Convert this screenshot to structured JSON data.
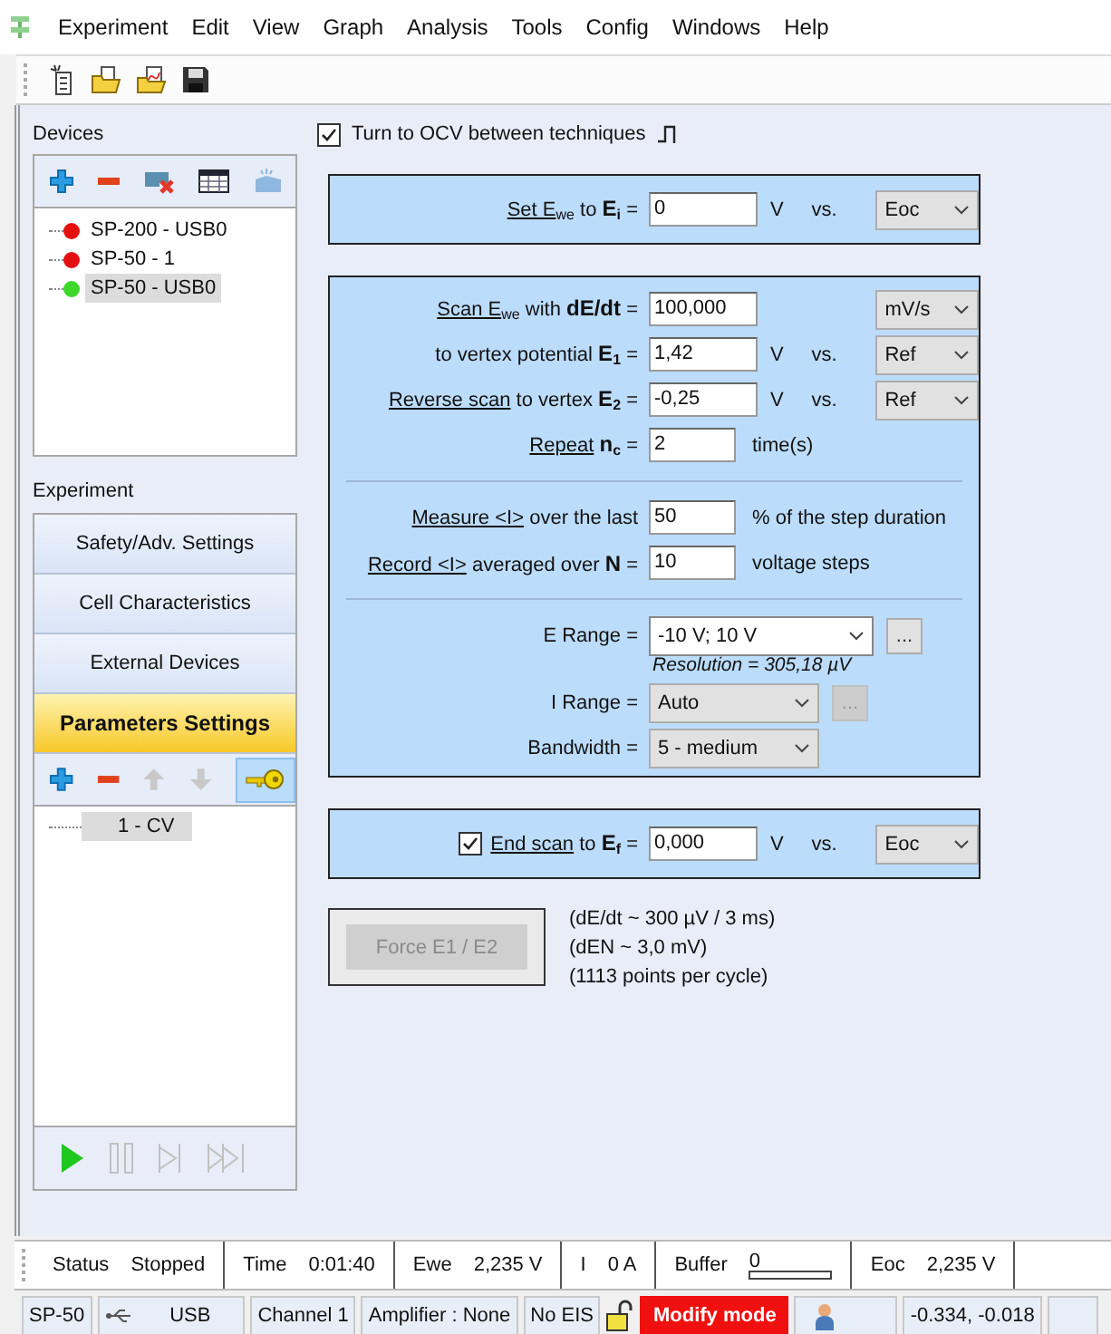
{
  "menu": [
    "Experiment",
    "Edit",
    "View",
    "Graph",
    "Analysis",
    "Tools",
    "Config",
    "Windows",
    "Help"
  ],
  "devices": {
    "label": "Devices",
    "items": [
      {
        "name": "SP-200 - USB0",
        "color": "#e41010",
        "selected": false
      },
      {
        "name": "SP-50 - 1",
        "color": "#e41010",
        "selected": false
      },
      {
        "name": "SP-50 - USB0",
        "color": "#3ed82a",
        "selected": true
      }
    ]
  },
  "experiment": {
    "label": "Experiment",
    "buttons": [
      {
        "label": "Safety/Adv. Settings",
        "selected": false
      },
      {
        "label": "Cell Characteristics",
        "selected": false
      },
      {
        "label": "External Devices",
        "selected": false
      },
      {
        "label": "Parameters Settings",
        "selected": true
      }
    ],
    "key_active": true,
    "techniques": [
      {
        "label": "1 - CV",
        "selected": true
      }
    ]
  },
  "ocv": {
    "label": "Turn to OCV between techniques",
    "checked": true
  },
  "set_ewe": {
    "link": "Set E$_{we}$",
    "label": "to **E**$_{i}$ =",
    "value": "0",
    "unit": "V",
    "vs": "vs.",
    "reference": "Eoc"
  },
  "scan": {
    "rows": [
      {
        "kind": "input",
        "link": "Scan E$_{we}$",
        "label": "with **dE/dt** =",
        "value": "100,000",
        "unit_select": "mV/s"
      },
      {
        "kind": "input",
        "label": "to vertex potential  **E**$_{1}$ =",
        "value": "1,42",
        "unit": "V",
        "vs": "vs.",
        "reference": "Ref"
      },
      {
        "kind": "input",
        "link": "Reverse scan",
        "label": "to vertex  **E**$_{2}$ =",
        "value": "-0,25",
        "unit": "V",
        "vs": "vs.",
        "reference": "Ref"
      },
      {
        "kind": "input",
        "link": "Repeat",
        "label": "**n**$_{c}$ =",
        "value": "2",
        "after": "time(s)"
      },
      {
        "kind": "divider"
      },
      {
        "kind": "input",
        "link": "Measure <I>",
        "label": "over the last",
        "value": "50",
        "after": "% of the step duration"
      },
      {
        "kind": "input",
        "link": "Record <I>",
        "label": "averaged over  **N** =",
        "value": "10",
        "after": "voltage steps"
      },
      {
        "kind": "divider"
      },
      {
        "kind": "range",
        "label": "E Range =",
        "value": "-10 V; 10 V",
        "editable": true,
        "more": "...",
        "more_disabled": false,
        "note": "Resolution = 305,18 µV"
      },
      {
        "kind": "range",
        "label": "I Range =",
        "value": "Auto",
        "editable": false,
        "more": "...",
        "more_disabled": true
      },
      {
        "kind": "range",
        "label": "Bandwidth =",
        "value": "5 - medium",
        "editable": false
      }
    ]
  },
  "end_scan": {
    "checked": true,
    "link": "End scan",
    "label": "to **E**$_{f}$ =",
    "value": "0,000",
    "unit": "V",
    "vs": "vs.",
    "reference": "Eoc"
  },
  "force_button": {
    "label": "Force E1 / E2",
    "disabled": true
  },
  "notes": [
    "(dE/dt ~ 300 µV / 3 ms)",
    "(dEN ~ 3,0 mV)",
    "(1113 points per cycle)"
  ],
  "status": [
    {
      "label": "Status",
      "value": "Stopped"
    },
    {
      "label": "Time",
      "value": "0:01:40"
    },
    {
      "label": "Ewe",
      "value": "2,235 V"
    },
    {
      "label": "I",
      "value": "0 A"
    },
    {
      "label": "Buffer",
      "value": "0",
      "kind": "buffer"
    },
    {
      "label": "Eoc",
      "value": "2,235 V"
    }
  ],
  "bottom": [
    {
      "kind": "text",
      "text": "SP-50"
    },
    {
      "kind": "usb",
      "text": "USB"
    },
    {
      "kind": "text",
      "text": "Channel 1"
    },
    {
      "kind": "text",
      "text": "Amplifier : None"
    },
    {
      "kind": "text",
      "text": "No EIS"
    },
    {
      "kind": "lock"
    },
    {
      "kind": "alert",
      "text": "Modify mode"
    },
    {
      "kind": "user"
    },
    {
      "kind": "text",
      "text": "-0.334, -0.018"
    }
  ]
}
